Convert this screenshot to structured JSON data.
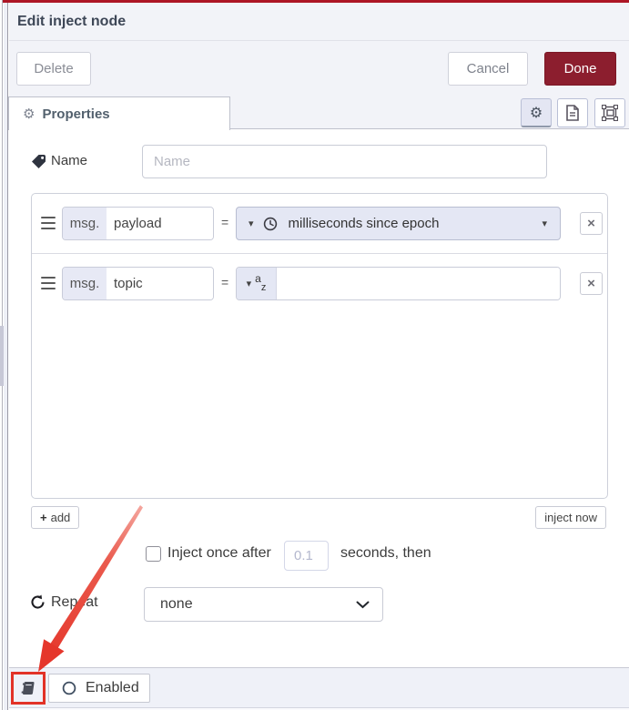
{
  "title": "Edit inject node",
  "actions": {
    "delete": "Delete",
    "cancel": "Cancel",
    "done": "Done"
  },
  "tab": {
    "label": "Properties"
  },
  "name": {
    "label": "Name",
    "placeholder": "Name"
  },
  "rows": [
    {
      "prefix": "msg.",
      "key": "payload",
      "equals": "=",
      "type": "timestamp",
      "value_label": "milliseconds since epoch"
    },
    {
      "prefix": "msg.",
      "key": "topic",
      "equals": "=",
      "type": "string",
      "value": ""
    }
  ],
  "list_actions": {
    "add": "add",
    "inject_now": "inject now"
  },
  "once": {
    "label_before": "Inject once after",
    "seconds_value": "0.1",
    "label_after": "seconds, then"
  },
  "repeat": {
    "label": "Repeat",
    "selected": "none"
  },
  "footer": {
    "enabled": "Enabled"
  },
  "icons": {
    "gear": "⚙",
    "plus": "+",
    "remove": "×",
    "caret_down": "▾",
    "az_a": "a",
    "az_z": "z"
  },
  "colors": {
    "top_line": "#ad1625",
    "done_bg": "#8c1e2e",
    "annotation_red": "#e5342a",
    "header_bg": "#f2f3f8",
    "typed_input_bg": "#e4e7f4"
  }
}
